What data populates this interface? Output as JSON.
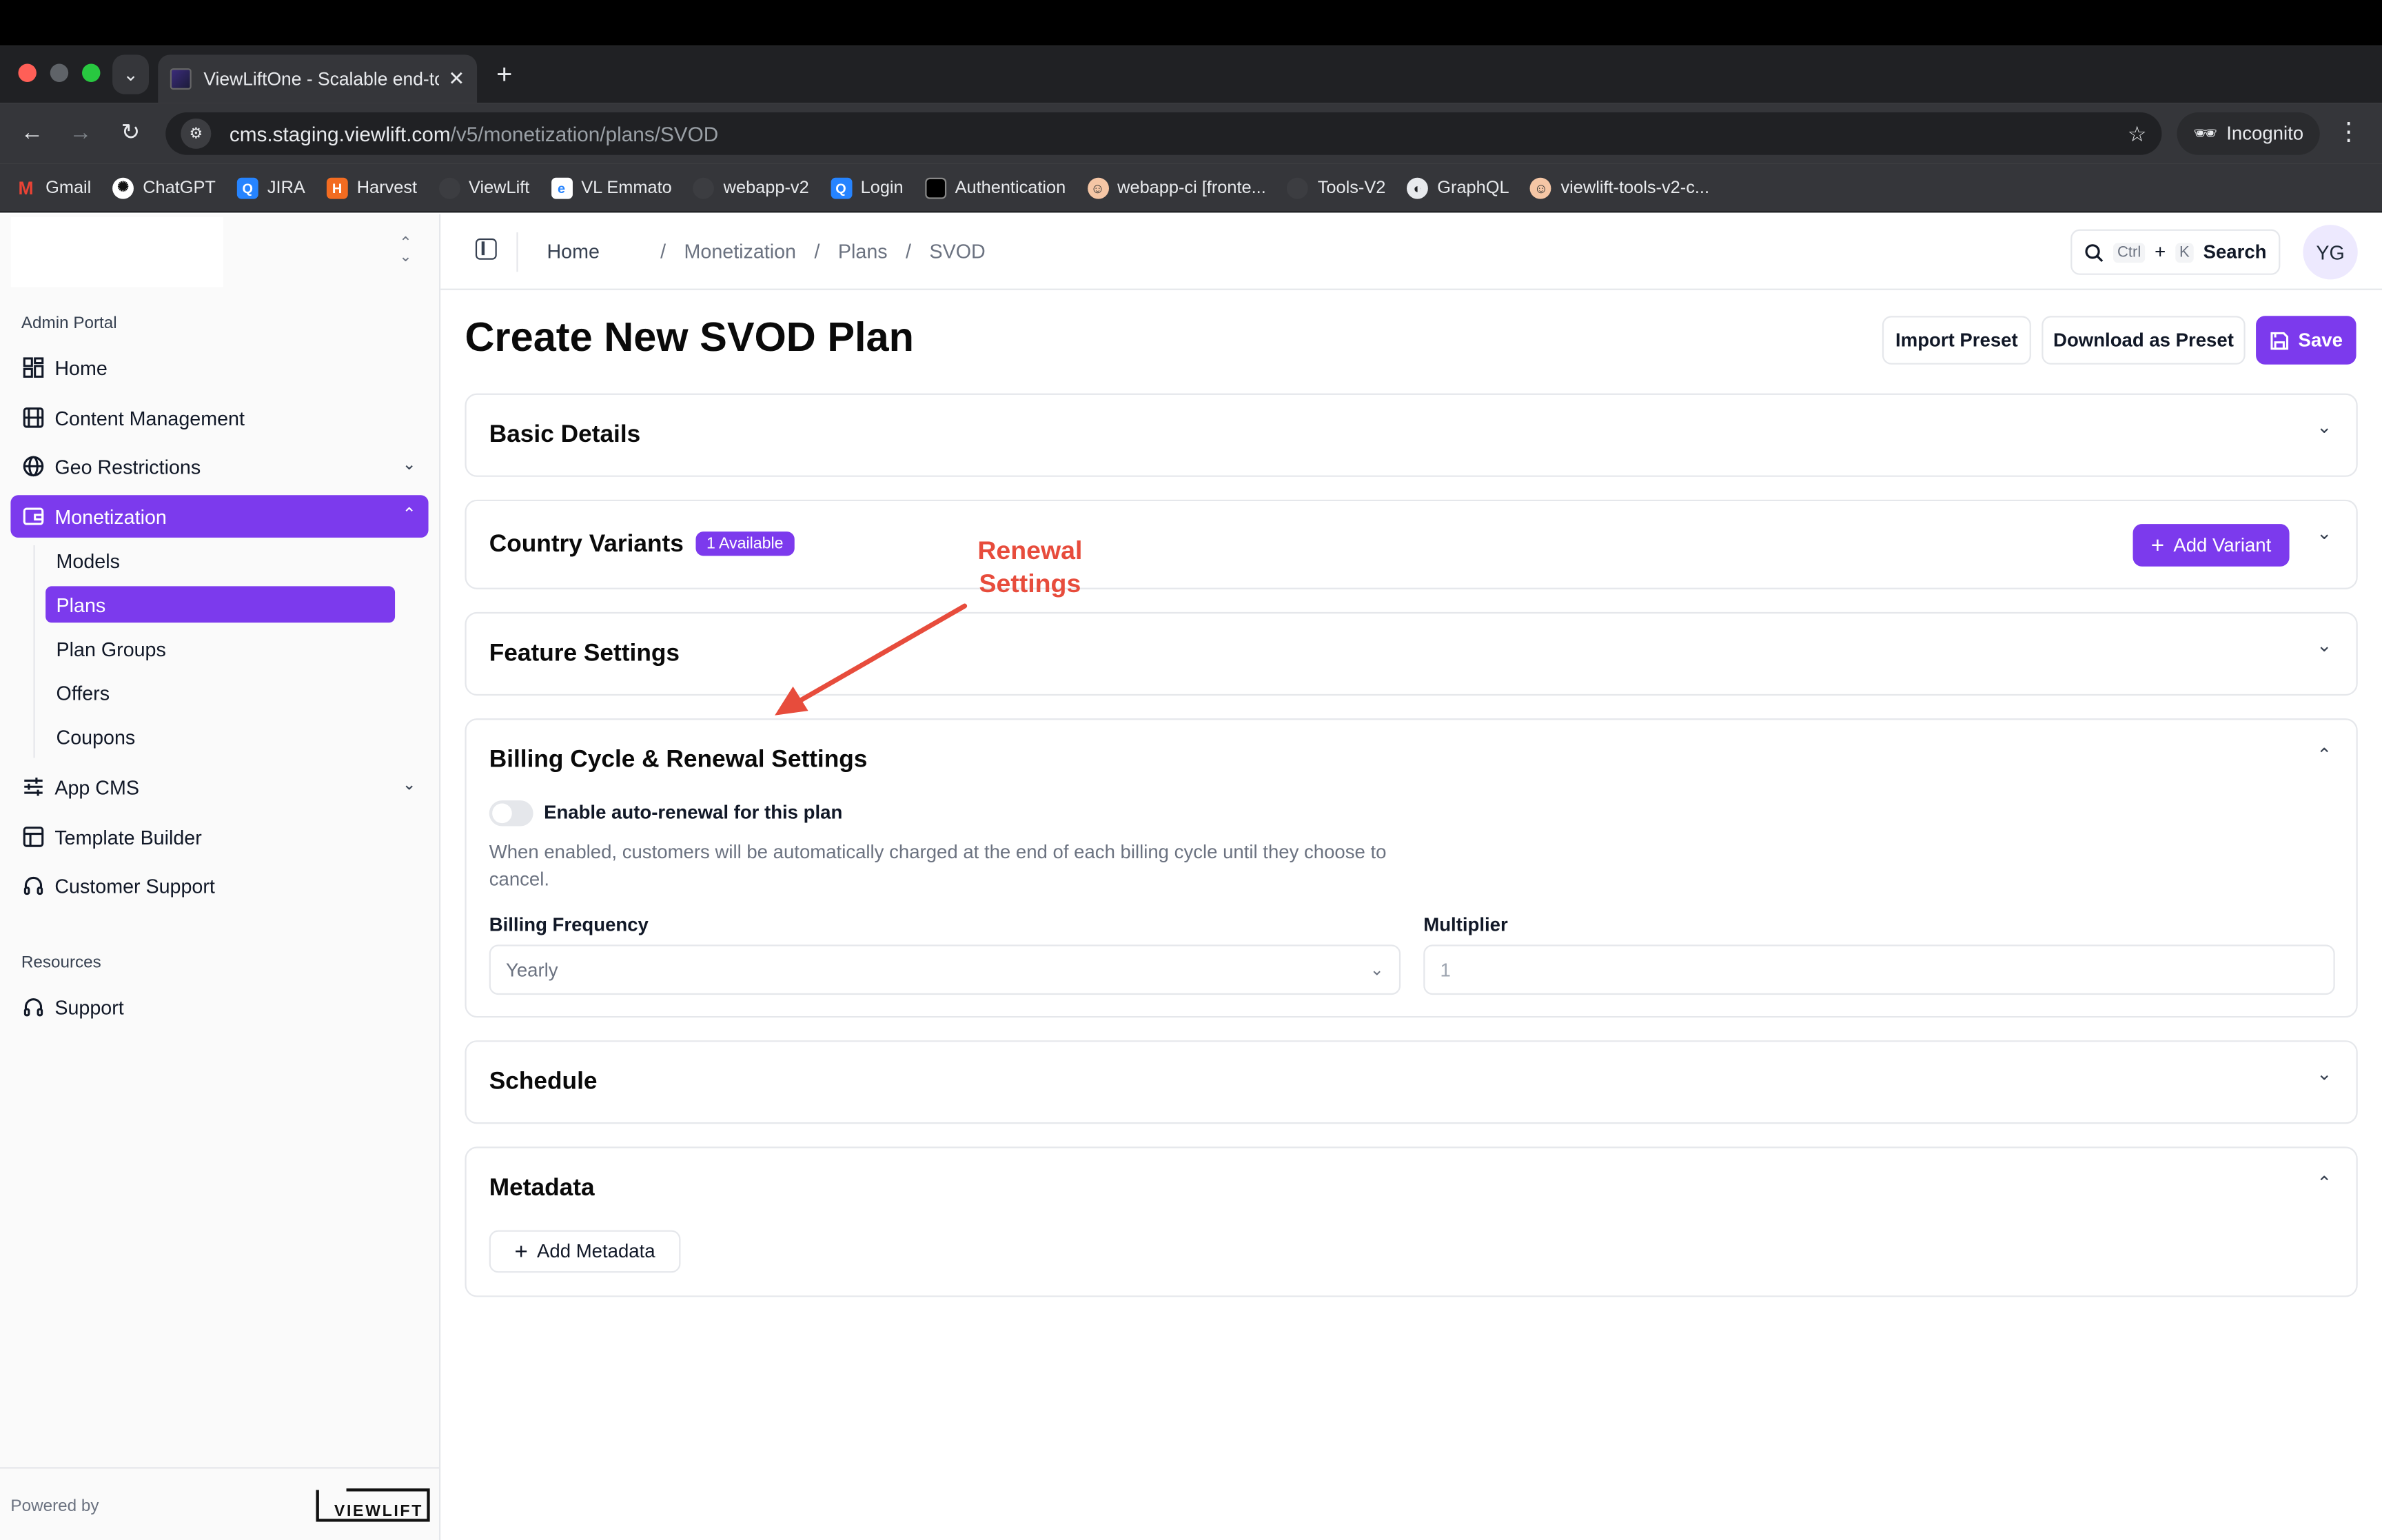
{
  "browser": {
    "tab_title": "ViewLiftOne - Scalable end-to",
    "new_tab": "+",
    "url_host": "cms.staging.viewlift.com",
    "url_path": "/v5/monetization/plans/SVOD",
    "incognito_label": "Incognito",
    "bookmarks": [
      {
        "label": "Gmail",
        "color": "#ea4335",
        "glyph": "M"
      },
      {
        "label": "ChatGPT",
        "color": "#111111",
        "glyph": "✺"
      },
      {
        "label": "JIRA",
        "color": "#2684ff",
        "glyph": "Q"
      },
      {
        "label": "Harvest",
        "color": "#f36c21",
        "glyph": "H"
      },
      {
        "label": "ViewLift",
        "color": "#202124",
        "glyph": "●"
      },
      {
        "label": "VL Emmato",
        "color": "#ffffff",
        "glyph": "e"
      },
      {
        "label": "webapp-v2",
        "color": "#202124",
        "glyph": "●"
      },
      {
        "label": "Login",
        "color": "#2684ff",
        "glyph": "Q"
      },
      {
        "label": "Authentication",
        "color": "#000000",
        "glyph": "▬"
      },
      {
        "label": "webapp-ci [fronte...",
        "color": "#f5c6a5",
        "glyph": "☺"
      },
      {
        "label": "Tools-V2",
        "color": "#202124",
        "glyph": "●"
      },
      {
        "label": "GraphQL",
        "color": "#202124",
        "glyph": "◐"
      },
      {
        "label": "viewlift-tools-v2-c...",
        "color": "#f5c6a5",
        "glyph": "☺"
      }
    ]
  },
  "sidebar": {
    "section_admin": "Admin Portal",
    "items": [
      {
        "label": "Home",
        "icon": "grid-icon"
      },
      {
        "label": "Content Management",
        "icon": "film-icon"
      },
      {
        "label": "Geo Restrictions",
        "icon": "globe-icon"
      },
      {
        "label": "Monetization",
        "icon": "wallet-icon"
      },
      {
        "label": "App CMS",
        "icon": "sliders-icon"
      },
      {
        "label": "Template Builder",
        "icon": "layout-icon"
      },
      {
        "label": "Customer Support",
        "icon": "headset-icon"
      }
    ],
    "subitems": [
      "Models",
      "Plans",
      "Plan Groups",
      "Offers",
      "Coupons"
    ],
    "section_resources": "Resources",
    "support": "Support",
    "powered_by": "Powered by",
    "logo_text": "VIEWLIFT"
  },
  "topbar": {
    "breadcrumbs": [
      "Home",
      "/",
      "Monetization",
      "/",
      "Plans",
      "/",
      "SVOD"
    ],
    "search_k1": "Ctrl",
    "search_plus": "+",
    "search_k2": "K",
    "search_label": "Search",
    "avatar": "YG"
  },
  "page": {
    "title": "Create New SVOD Plan",
    "import_preset": "Import Preset",
    "download_preset": "Download as Preset",
    "save": "Save"
  },
  "cards": {
    "basic": "Basic Details",
    "country": "Country Variants",
    "country_badge": "1 Available",
    "add_variant": "Add Variant",
    "feature": "Feature Settings",
    "billing": "Billing Cycle & Renewal Settings",
    "auto_renew_label": "Enable auto-renewal for this plan",
    "auto_renew_enabled": false,
    "auto_renew_help": "When enabled, customers will be automatically charged at the end of each billing cycle until they choose to cancel.",
    "billing_frequency_label": "Billing Frequency",
    "billing_frequency_value": "Yearly",
    "multiplier_label": "Multiplier",
    "multiplier_placeholder": "1",
    "schedule": "Schedule",
    "metadata": "Metadata",
    "add_metadata": "Add Metadata"
  },
  "annotation": {
    "line1": "Renewal",
    "line2": "Settings",
    "color": "#e74c3c"
  },
  "colors": {
    "accent": "#7c3aed"
  }
}
